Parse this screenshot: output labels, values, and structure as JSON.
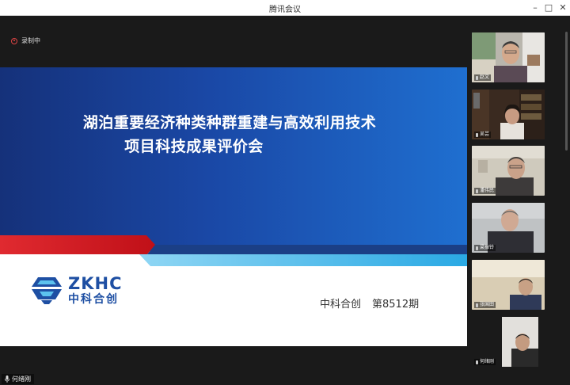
{
  "window": {
    "title": "腾讯会议"
  },
  "recording": {
    "label": "录制中"
  },
  "slide": {
    "title_line1": "湖泊重要经济种类种群重建与高效利用技术",
    "title_line2": "项目科技成果评价会",
    "logo_en": "ZKHC",
    "logo_cn": "中科合创",
    "org": "中科合创",
    "issue": "第8512期"
  },
  "self": {
    "name": "何绪刚"
  },
  "participants": [
    {
      "name": "赵文"
    },
    {
      "name": "吴芸"
    },
    {
      "name": "潘伟民"
    },
    {
      "name": "梁振铃"
    },
    {
      "name": "张国田"
    },
    {
      "name": "何绪刚"
    }
  ],
  "colors": {
    "slide_blue": "#1a4aa8",
    "slide_red": "#d8202a",
    "slide_cyan": "#34b4e6",
    "logo_blue": "#1e4fa3"
  }
}
